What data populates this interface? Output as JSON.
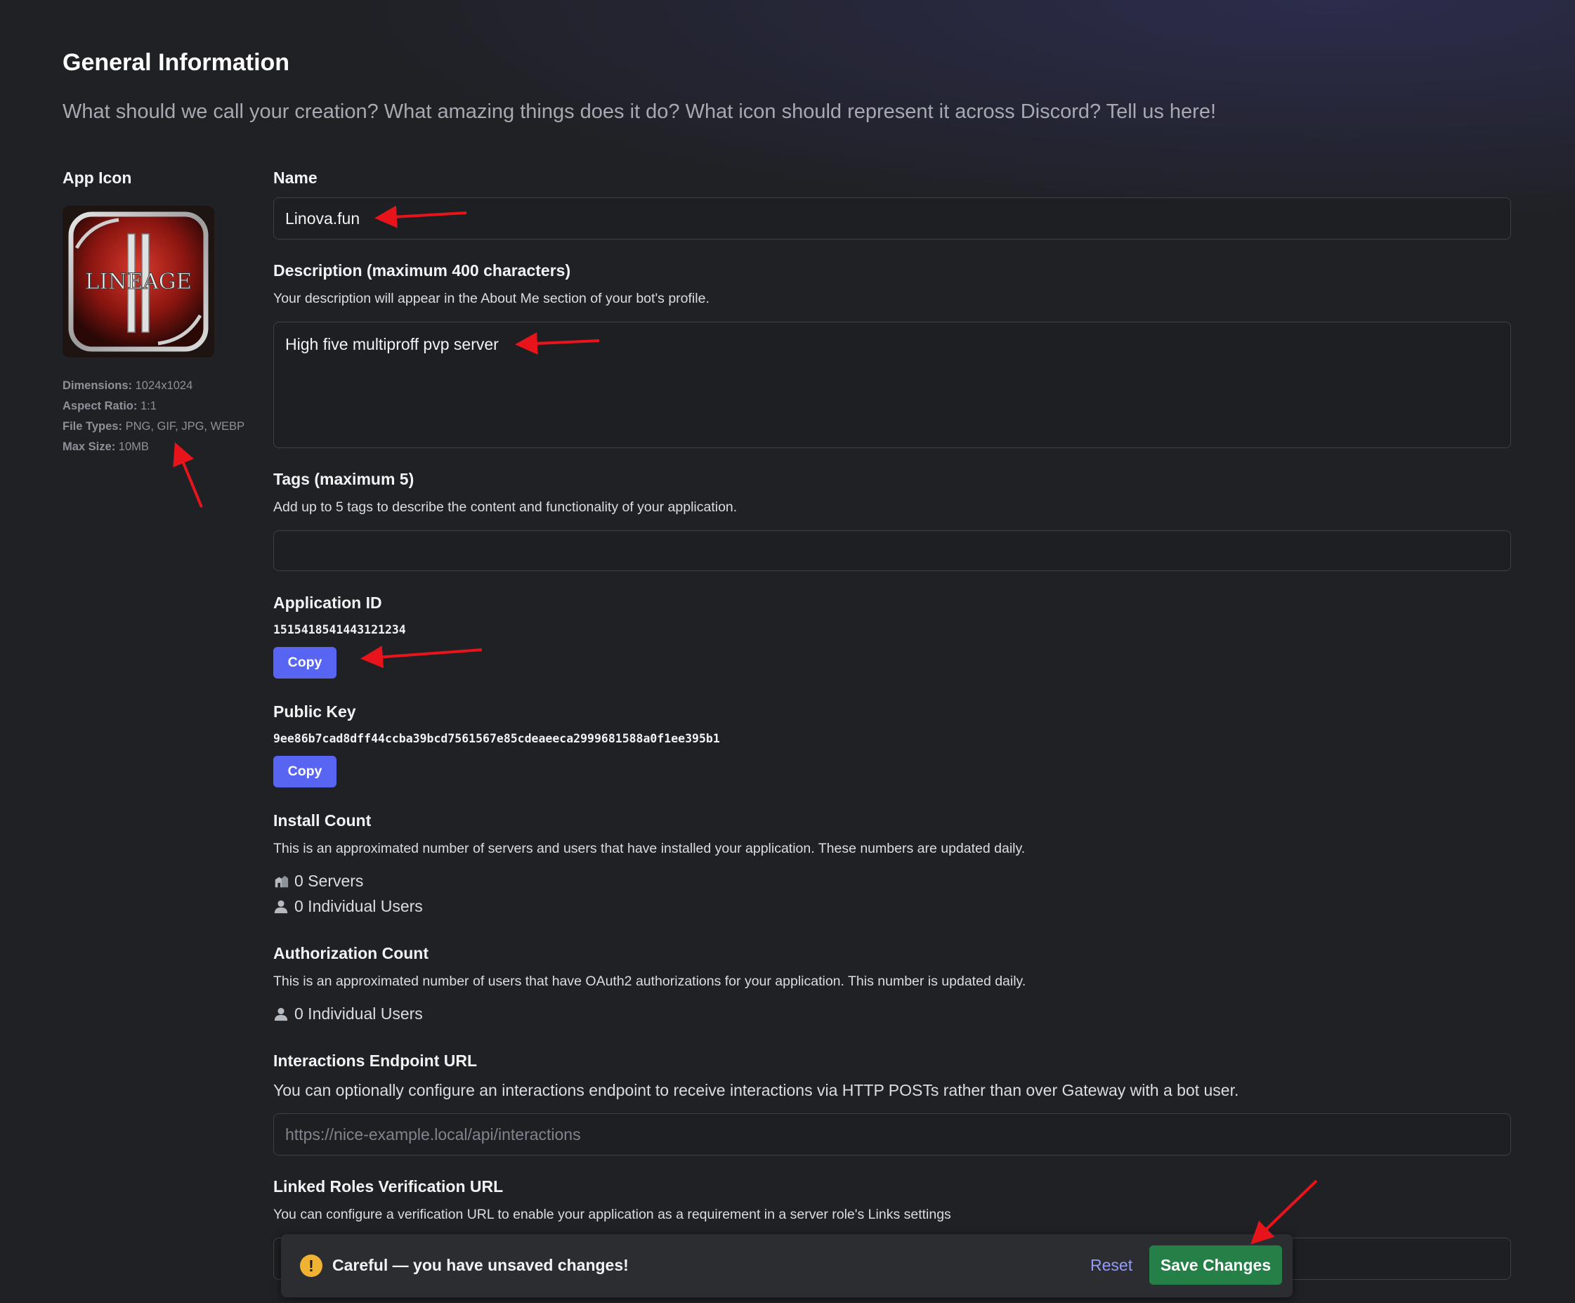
{
  "header": {
    "title": "General Information",
    "subtitle": "What should we call your creation? What amazing things does it do? What icon should represent it across Discord? Tell us here!"
  },
  "app_icon": {
    "label": "App Icon",
    "image_text": "LINEAGE",
    "dimensions_label": "Dimensions:",
    "dimensions_value": "1024x1024",
    "aspect_label": "Aspect Ratio:",
    "aspect_value": "1:1",
    "file_types_label": "File Types:",
    "file_types_value": "PNG, GIF, JPG, WEBP",
    "max_size_label": "Max Size:",
    "max_size_value": "10MB"
  },
  "name": {
    "label": "Name",
    "value": "Linova.fun"
  },
  "description": {
    "label": "Description (maximum 400 characters)",
    "help": "Your description will appear in the About Me section of your bot's profile.",
    "value": "High five multiproff pvp server"
  },
  "tags": {
    "label": "Tags (maximum 5)",
    "help": "Add up to 5 tags to describe the content and functionality of your application.",
    "value": ""
  },
  "application_id": {
    "label": "Application ID",
    "value": "1515418541443121234",
    "copy_label": "Copy"
  },
  "public_key": {
    "label": "Public Key",
    "value": "9ee86b7cad8dff44ccba39bcd7561567e85cdeaeeca2999681588a0f1ee395b1",
    "copy_label": "Copy"
  },
  "install_count": {
    "label": "Install Count",
    "help": "This is an approximated number of servers and users that have installed your application. These numbers are updated daily.",
    "servers": "0 Servers",
    "users": "0 Individual Users"
  },
  "authorization_count": {
    "label": "Authorization Count",
    "help": "This is an approximated number of users that have OAuth2 authorizations for your application. This number is updated daily.",
    "users": "0 Individual Users"
  },
  "interactions": {
    "label": "Interactions Endpoint URL",
    "help": "You can optionally configure an interactions endpoint to receive interactions via HTTP POSTs rather than over Gateway with a bot user.",
    "placeholder": "https://nice-example.local/api/interactions",
    "value": ""
  },
  "linked_roles": {
    "label": "Linked Roles Verification URL",
    "help": "You can configure a verification URL to enable your application as a requirement in a server role's Links settings",
    "value": ""
  },
  "notice": {
    "text": "Careful — you have unsaved changes!",
    "reset_label": "Reset",
    "save_label": "Save Changes"
  },
  "colors": {
    "accent": "#5865f2",
    "save": "#248046",
    "warning": "#f0b232",
    "annotation_arrow": "#e8141b"
  },
  "icons": [
    "warning-icon",
    "server-icon",
    "user-icon",
    "user-icon"
  ]
}
